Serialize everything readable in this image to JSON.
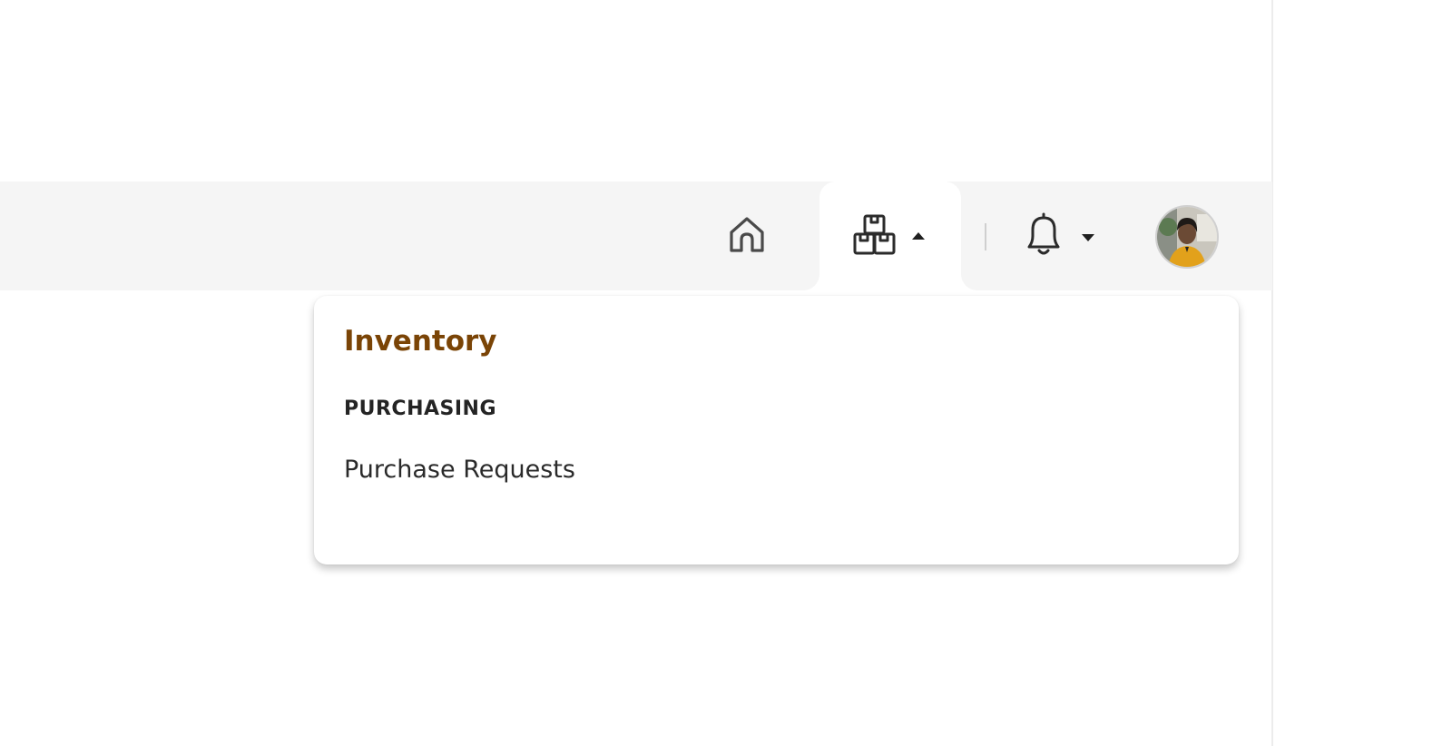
{
  "nav": {
    "home_icon": "home-icon",
    "inventory_icon": "boxes-icon",
    "inventory_menu_open": true,
    "notifications_icon": "bell-icon",
    "avatar_alt": "User avatar"
  },
  "dropdown": {
    "title": "Inventory",
    "sections": [
      {
        "heading": "PURCHASING",
        "items": [
          {
            "label": "Purchase Requests"
          }
        ]
      }
    ]
  },
  "colors": {
    "topbar_bg": "#f5f5f5",
    "accent_title": "#7a4406",
    "text_dark": "#242424",
    "icon_stroke": "#3a3a3a"
  }
}
